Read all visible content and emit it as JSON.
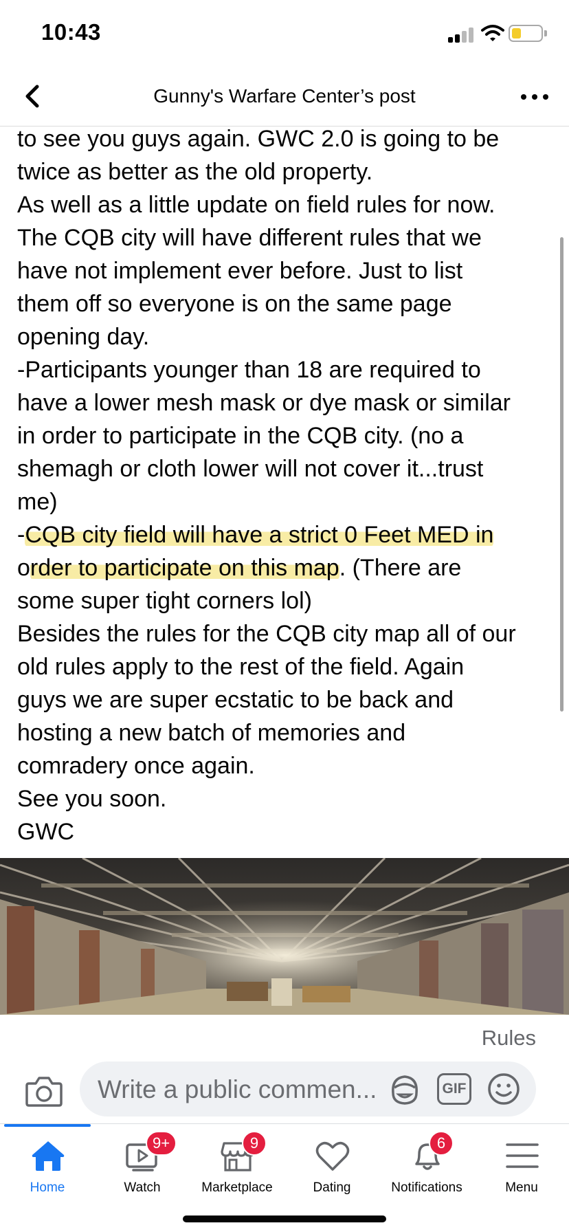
{
  "status_bar": {
    "time": "10:43",
    "battery_color": "#f4cc2a"
  },
  "header": {
    "title": "Gunny's Warfare Center’s post",
    "back_icon": "chevron-left-icon",
    "more_icon": "more-dots-icon"
  },
  "post": {
    "lines": [
      "to see you guys again. GWC 2.0 is going to be",
      "twice as better as the old property.",
      "As well as a little update on field rules for now.",
      "The CQB city will have different rules that we",
      "have not implement ever before. Just to list",
      "them off so everyone is on the same page",
      "opening day.",
      "-Participants younger than 18 are required to",
      "have a lower mesh mask or dye mask or similar",
      "in order to participate in the CQB city. (no a",
      "shemagh or cloth lower will not cover it...trust",
      "me)"
    ],
    "highlight_line_1": {
      "prefix": "-",
      "highlighted": "CQB city field will have a strict 0 Feet MED in"
    },
    "highlight_line_2": {
      "prefix": "o",
      "highlighted": "rder to participate on this map",
      "suffix": ". (There are"
    },
    "lines_after": [
      "some super tight corners lol)",
      "Besides the rules for the CQB city map all of our",
      "old rules apply to the rest of the field. Again",
      "guys we are super ecstatic to be back and",
      "hosting a new batch of memories and",
      "comradery once again.",
      "See you soon.",
      "GWC"
    ],
    "highlight_color": "#f6e68c"
  },
  "photo": {
    "subject": "barn interior with wooden roof beams"
  },
  "rules_label": "Rules",
  "comment": {
    "placeholder": "Write a public commen...",
    "gif_label": "GIF",
    "camera_icon": "camera-icon",
    "avatar_icon": "avatar-sticker-icon",
    "emoji_icon": "emoji-icon"
  },
  "tabs": [
    {
      "label": "Home",
      "icon": "home-icon",
      "active": true,
      "badge": ""
    },
    {
      "label": "Watch",
      "icon": "watch-icon",
      "active": false,
      "badge": "9+"
    },
    {
      "label": "Marketplace",
      "icon": "marketplace-icon",
      "active": false,
      "badge": "9"
    },
    {
      "label": "Dating",
      "icon": "heart-icon",
      "active": false,
      "badge": ""
    },
    {
      "label": "Notifications",
      "icon": "bell-icon",
      "active": false,
      "badge": "6"
    },
    {
      "label": "Menu",
      "icon": "menu-icon",
      "active": false,
      "badge": ""
    }
  ],
  "colors": {
    "accent": "#1877f2",
    "badge": "#e41e3f",
    "muted_text": "#65676b"
  }
}
